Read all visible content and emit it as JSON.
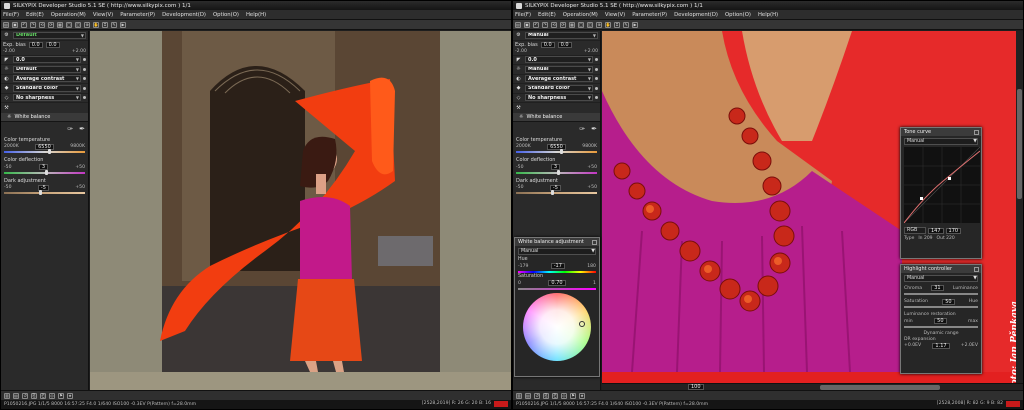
{
  "app": {
    "title": "SILKYPIX Developer Studio 5.1 SE ( http://www.silkypix.com )  1/1"
  },
  "menu": [
    "File(F)",
    "Edit(E)",
    "Operation(M)",
    "View(V)",
    "Parameter(P)",
    "Development(D)",
    "Option(O)",
    "Help(H)"
  ],
  "left": {
    "taste": "Default",
    "exposure": {
      "label": "Exp. bias",
      "value": "0.0",
      "value2": "0.0",
      "min": "-2.00",
      "max": "+2.00"
    },
    "gamma": "0.0",
    "white_balance": "Default",
    "tone": "Average contrast",
    "color": "Standard color",
    "sharpness": "No sharpness",
    "wb_tab": "White balance",
    "ct": {
      "label": "Color temperature",
      "min": "2000K",
      "value": "6550",
      "max": "9800K",
      "frac": 0.56
    },
    "cd": {
      "label": "Color deflection",
      "min": "-50",
      "value": "3",
      "max": "+50",
      "frac": 0.53
    },
    "skin": {
      "label": "Dark adjustment",
      "min": "-50",
      "value": "-5",
      "max": "+50",
      "frac": 0.45
    },
    "status": "P1050216.JPG 1/1/5 8000  16:57:25 F4.0 1/640  ISO100  -0.3EV P(Pattern) f=28.0mm",
    "status_right": "[2528,2019] R: 26 G: 20 B: 16"
  },
  "right": {
    "taste": "Manual",
    "exposure": {
      "label": "Exp. bias",
      "value": "0.0",
      "value2": "0.0",
      "min": "-2.00",
      "max": "+2.00"
    },
    "gamma": "0.0",
    "white_balance": "Manual",
    "tone": "Average contrast",
    "color": "Standard color",
    "sharpness": "No sharpness",
    "wb_tab": "White balance",
    "ct": {
      "label": "Color temperature",
      "min": "2000K",
      "value": "6550",
      "max": "9800K",
      "frac": 0.56
    },
    "cd": {
      "label": "Color deflection",
      "min": "-50",
      "value": "3",
      "max": "+50",
      "frac": 0.53
    },
    "skin": {
      "label": "Dark adjustment",
      "min": "-50",
      "value": "-5",
      "max": "+50",
      "frac": 0.45
    },
    "wba": {
      "title": "White balance adjustment",
      "mode": "Manual",
      "hue_label": "Hue",
      "hue_min": "-179",
      "hue": "-17",
      "hue_max": "180",
      "sat_label": "Saturation",
      "sat_min": "0",
      "sat": "0.70",
      "sat_max": "1"
    },
    "tone_curve": {
      "title": "Tone curve",
      "mode": "Manual",
      "channel": "RGB",
      "v1": "147",
      "v2": "170",
      "type": "Type",
      "in": "In 209",
      "out": "Out 220"
    },
    "highlight": {
      "title": "Highlight controller",
      "mode": "Manual",
      "chroma": "Chroma",
      "chroma_v": "31",
      "luminance": "Luminance",
      "sat": "Saturation",
      "sat_v": "50",
      "hue": "Hue",
      "lum_rest": "Luminance restoration",
      "lum_min": "min",
      "lum_v": "50",
      "lum_max": "max",
      "dyn": "Dynamic range",
      "dr": "DR expansion",
      "dr_min": "+0.0EV",
      "dr_v": "1.17",
      "dr_max": "+2.0EV"
    },
    "zoom": "100",
    "status": "P1050216.JPG 1/1/5 8000  16:57:25 F4.0 1/640  ISO100  -0.3EV P(Pattern) f=28.0mm",
    "status_right": "[2528,2008] R: 82 G: 9 B: 82",
    "watermark": "©Foto: Jan Pěnkava"
  }
}
